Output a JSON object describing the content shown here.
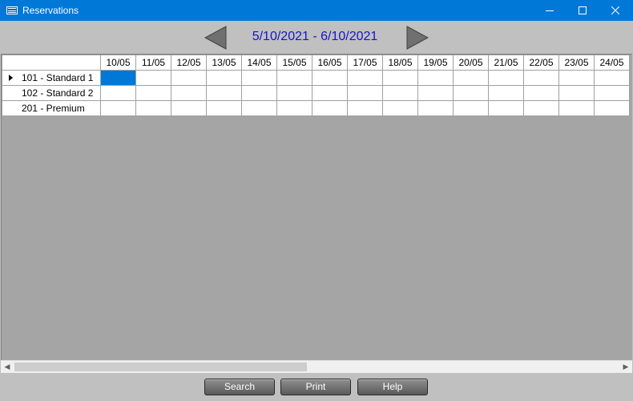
{
  "window": {
    "title": "Reservations",
    "icon": "calendar-window-icon"
  },
  "window_controls": {
    "minimize_icon": "minimize-icon",
    "maximize_icon": "maximize-icon",
    "close_icon": "close-icon"
  },
  "nav": {
    "date_range": "5/10/2021 - 6/10/2021",
    "prev_icon": "left-triangle-icon",
    "next_icon": "right-triangle-icon"
  },
  "grid": {
    "dates": [
      "10/05",
      "11/05",
      "12/05",
      "13/05",
      "14/05",
      "15/05",
      "16/05",
      "17/05",
      "18/05",
      "19/05",
      "20/05",
      "21/05",
      "22/05",
      "23/05",
      "24/05"
    ],
    "rooms": [
      {
        "label": "101 - Standard 1",
        "current": true
      },
      {
        "label": "102 - Standard 2",
        "current": false
      },
      {
        "label": "201 - Premium",
        "current": false
      }
    ],
    "selected_cell": {
      "room": "101 - Standard 1",
      "date": "10/05"
    },
    "selection_color": "#0078d7"
  },
  "scrollbar": {
    "left_icon": "scroll-left-icon",
    "right_icon": "scroll-right-icon"
  },
  "buttons": {
    "search_label": "Search",
    "print_label": "Print",
    "help_label": "Help"
  },
  "colors": {
    "titlebar": "#0078d7",
    "date_range_text": "#1515c8",
    "background": "#c0c0c0",
    "grid_empty": "#a5a5a5"
  }
}
